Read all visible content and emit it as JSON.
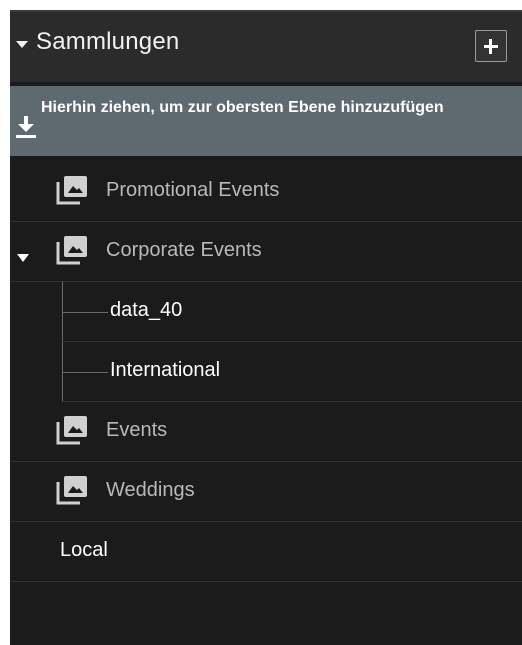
{
  "panel": {
    "title": "Sammlungen",
    "add_button_label": "+",
    "dropzone_text": "Hierhin ziehen, um zur obersten Ebene hinzuzufügen",
    "collections": [
      {
        "label": "Promotional Events",
        "icon": "collection-icon"
      },
      {
        "label": "Corporate Events",
        "icon": "collection-icon",
        "expanded": true
      },
      {
        "label": "data_40"
      },
      {
        "label": "International"
      },
      {
        "label": "Events",
        "icon": "collection-icon"
      },
      {
        "label": "Weddings",
        "icon": "collection-icon"
      },
      {
        "label": "Local"
      }
    ]
  },
  "colors": {
    "panel_bg": "#1b1b1b",
    "header_bg": "#2b2b2b",
    "dropzone_bg": "#5f6a70",
    "text_muted": "#b9b9b9",
    "text_bright": "#ffffff"
  }
}
